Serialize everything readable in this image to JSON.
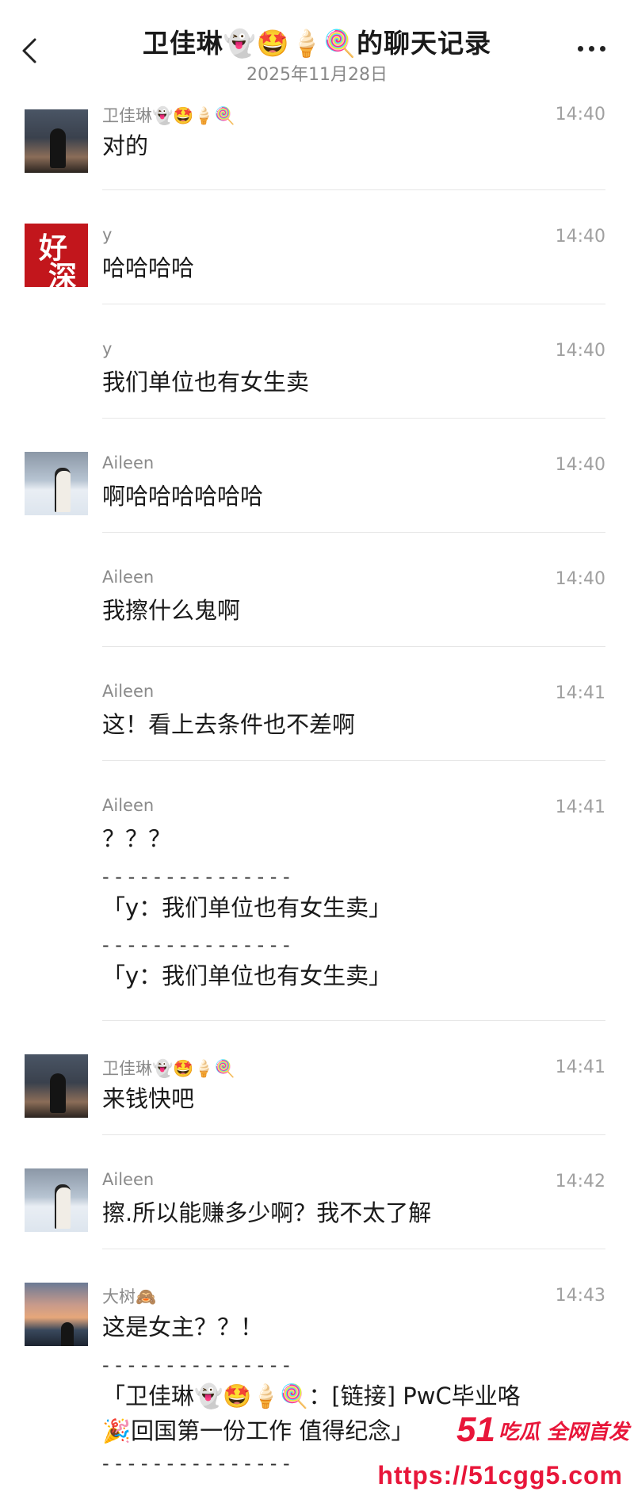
{
  "header": {
    "title": "卫佳琳👻🤩🍦🍭的聊天记录",
    "date": "2025年11月28日"
  },
  "messages": [
    {
      "name": "卫佳琳👻🤩🍦🍭",
      "time": "14:40",
      "text": "对的",
      "avatar": "night"
    },
    {
      "name": "y",
      "time": "14:40",
      "text": "哈哈哈哈",
      "avatar": "red-calligraphy"
    },
    {
      "name": "y",
      "time": "14:40",
      "text": "我们单位也有女生卖",
      "avatar": ""
    },
    {
      "name": "Aileen",
      "time": "14:40",
      "text": "啊哈哈哈哈哈哈",
      "avatar": "snow"
    },
    {
      "name": "Aileen",
      "time": "14:40",
      "text": "我擦什么鬼啊",
      "avatar": ""
    },
    {
      "name": "Aileen",
      "time": "14:41",
      "text": "这！看上去条件也不差啊",
      "avatar": ""
    },
    {
      "name": "Aileen",
      "time": "14:41",
      "text": "？？？",
      "avatar": "",
      "quotes": [
        "- - - - - - - - - - - - - - -",
        "「y：我们单位也有女生卖」",
        "- - - - - - - - - - - - - - -",
        "「y：我们单位也有女生卖」"
      ]
    },
    {
      "name": "卫佳琳👻🤩🍦🍭",
      "time": "14:41",
      "text": "来钱快吧",
      "avatar": "night"
    },
    {
      "name": "Aileen",
      "time": "14:42",
      "text": "擦.所以能赚多少啊？我不太了解",
      "avatar": "snow"
    },
    {
      "name": "大树🙈",
      "time": "14:43",
      "text": "这是女主？？！",
      "avatar": "sunset",
      "quotes": [
        "- - - - - - - - - - - - - - -",
        "「卫佳琳👻🤩🍦🍭：[链接] PwC毕业咯",
        "🎉回国第一份工作 值得纪念」",
        "- - - - - - - - - - - - - - -"
      ]
    }
  ],
  "avatar_calligraphy": [
    "好",
    "深"
  ],
  "watermark": {
    "brand_num": "51",
    "brand_text": "吃瓜 全网首发",
    "url": "https://51cgg5.com"
  },
  "colors": {
    "accent": "#e8163a",
    "name_gray": "#8a8a8a",
    "time_gray": "#a0a0a0"
  }
}
